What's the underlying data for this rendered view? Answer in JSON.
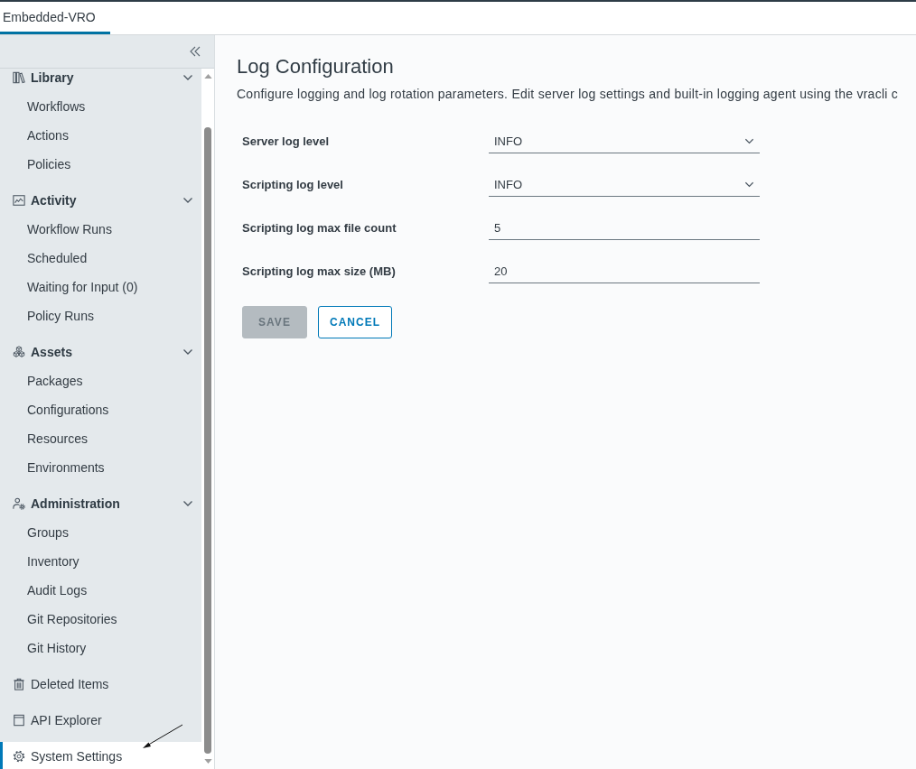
{
  "header": {
    "tabs": [
      {
        "label": "Embedded-VRO",
        "selected": true
      }
    ]
  },
  "sidebar": {
    "items": [
      {
        "kind": "group",
        "label": "Library",
        "expanded": true,
        "children": [
          {
            "label": "Workflows",
            "selected": false
          },
          {
            "label": "Actions",
            "selected": false
          },
          {
            "label": "Policies",
            "selected": false
          }
        ]
      },
      {
        "kind": "group",
        "label": "Activity",
        "expanded": true,
        "children": [
          {
            "label": "Workflow Runs",
            "selected": false
          },
          {
            "label": "Scheduled",
            "selected": false
          },
          {
            "label": "Waiting for Input (0)",
            "selected": false
          },
          {
            "label": "Policy Runs",
            "selected": false
          }
        ]
      },
      {
        "kind": "group",
        "label": "Assets",
        "expanded": true,
        "children": [
          {
            "label": "Packages",
            "selected": false
          },
          {
            "label": "Configurations",
            "selected": false
          },
          {
            "label": "Resources",
            "selected": false
          },
          {
            "label": "Environments",
            "selected": false
          }
        ]
      },
      {
        "kind": "group",
        "label": "Administration",
        "expanded": true,
        "children": [
          {
            "label": "Groups",
            "selected": false
          },
          {
            "label": "Inventory",
            "selected": false
          },
          {
            "label": "Audit Logs",
            "selected": false
          },
          {
            "label": "Git Repositories",
            "selected": false
          },
          {
            "label": "Git History",
            "selected": false
          }
        ]
      },
      {
        "kind": "link",
        "label": "Deleted Items",
        "selected": false
      },
      {
        "kind": "link",
        "label": "API Explorer",
        "selected": false
      },
      {
        "kind": "link",
        "label": "System Settings",
        "selected": true
      }
    ]
  },
  "page": {
    "title": "Log Configuration",
    "description": "Configure logging and log rotation parameters. Edit server log settings and built-in logging agent using the vracli c",
    "fields": [
      {
        "label": "Server log level",
        "kind": "select",
        "value": "INFO"
      },
      {
        "label": "Scripting log level",
        "kind": "select",
        "value": "INFO"
      },
      {
        "label": "Scripting log max file count",
        "kind": "number",
        "value": "5"
      },
      {
        "label": "Scripting log max size (MB)",
        "kind": "number",
        "value": "20"
      }
    ],
    "buttons": [
      {
        "label": "SAVE",
        "kind": "primary",
        "disabled": true
      },
      {
        "label": "CANCEL",
        "kind": "outline",
        "disabled": false
      }
    ]
  }
}
